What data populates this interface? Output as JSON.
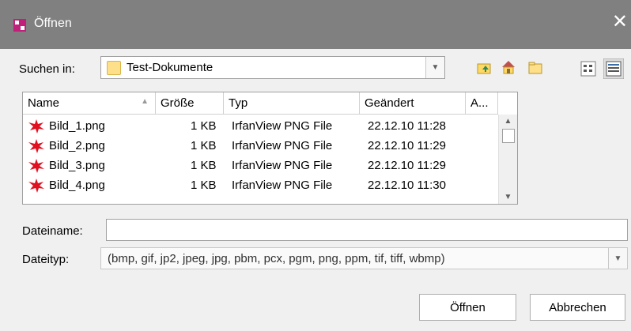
{
  "window": {
    "title": "Öffnen",
    "close_glyph": "✕"
  },
  "look_in": {
    "label": "Suchen in:",
    "value": "Test-Dokumente"
  },
  "toolbar": {
    "icons": [
      "up-folder-icon",
      "home-icon",
      "new-folder-icon",
      "list-view-icon",
      "details-view-icon"
    ]
  },
  "table": {
    "headers": [
      "Name",
      "Größe",
      "Typ",
      "Geändert",
      "A..."
    ],
    "rows": [
      {
        "name": "Bild_1.png",
        "size": "1 KB",
        "type": "IrfanView PNG File",
        "modified": "22.12.10 11:28"
      },
      {
        "name": "Bild_2.png",
        "size": "1 KB",
        "type": "IrfanView PNG File",
        "modified": "22.12.10 11:29"
      },
      {
        "name": "Bild_3.png",
        "size": "1 KB",
        "type": "IrfanView PNG File",
        "modified": "22.12.10 11:29"
      },
      {
        "name": "Bild_4.png",
        "size": "1 KB",
        "type": "IrfanView PNG File",
        "modified": "22.12.10 11:30"
      }
    ]
  },
  "filename": {
    "label": "Dateiname:",
    "value": ""
  },
  "filetype": {
    "label": "Dateityp:",
    "value": "(bmp, gif, jp2, jpeg, jpg, pbm, pcx, pgm, png, ppm, tif, tiff, wbmp)"
  },
  "buttons": {
    "open": "Öffnen",
    "cancel": "Abbrechen"
  },
  "colors": {
    "titlebar": "#808080",
    "dialog_bg": "#f0f0f0",
    "file_icon": "#e01020",
    "folder": "#ffe08a"
  }
}
